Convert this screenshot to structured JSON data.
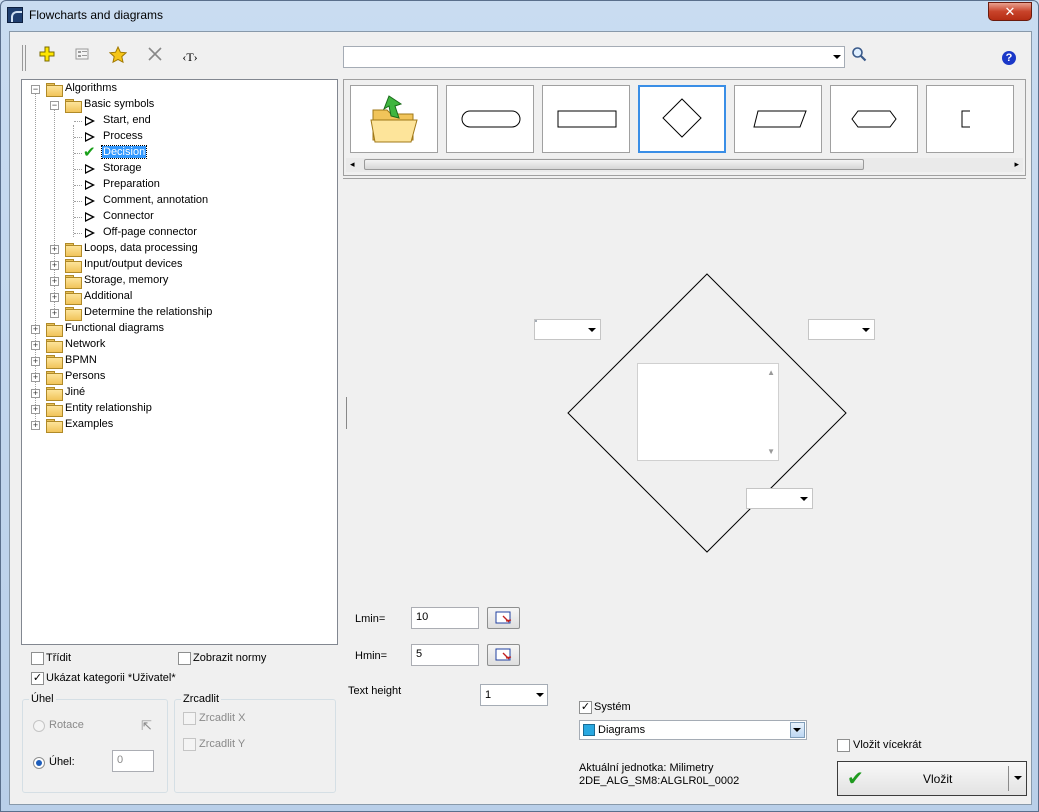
{
  "window": {
    "title": "Flowcharts and diagrams",
    "close": "✕"
  },
  "toolbar": {
    "search_value": "",
    "help": "?",
    "text_button": "‹T›"
  },
  "tree": {
    "top_nodes": [
      "Algorithms",
      "Functional diagrams",
      "Network",
      "BPMN",
      "Persons",
      "Jiné",
      "Entity relationship",
      "Examples"
    ],
    "algorithms_children": [
      "Basic symbols",
      "Loops, data processing",
      "Input/output devices",
      "Storage, memory",
      "Additional",
      "Determine the relationship"
    ],
    "basic_symbols": [
      "Start, end",
      "Process",
      "Decision",
      "Storage",
      "Preparation",
      "Comment, annotation",
      "Connector",
      "Off-page connector"
    ],
    "selected": "Decision"
  },
  "preview": {
    "lmin_label": "Lmin=",
    "lmin_value": "10",
    "hmin_label": "Hmin=",
    "hmin_value": "5"
  },
  "options": {
    "sort_label": "Třídit",
    "show_norms_label": "Zobrazit normy",
    "show_category_label": "Ukázat kategorii *Uživatel*",
    "angle_group": "Úhel",
    "rotation_label": "Rotace",
    "angle_label": "Úhel:",
    "angle_value": "0",
    "mirror_group": "Zrcadlit",
    "mirror_x_label": "Zrcadlit X",
    "mirror_y_label": "Zrcadlit Y",
    "text_height_label": "Text height",
    "text_height_value": "1",
    "system_label": "Systém",
    "layer_value": "Diagrams",
    "unit_text": "Aktuální jednotka: Milimetry",
    "code_text": "2DE_ALG_SM8:ALGLR0L_0002",
    "insert_multiple_label": "Vložit vícekrát",
    "insert_label": "Vložit"
  },
  "colors": {
    "accent": "#3a8ee6",
    "selection": "#3399ff",
    "layer_swatch": "#29a8e0"
  }
}
